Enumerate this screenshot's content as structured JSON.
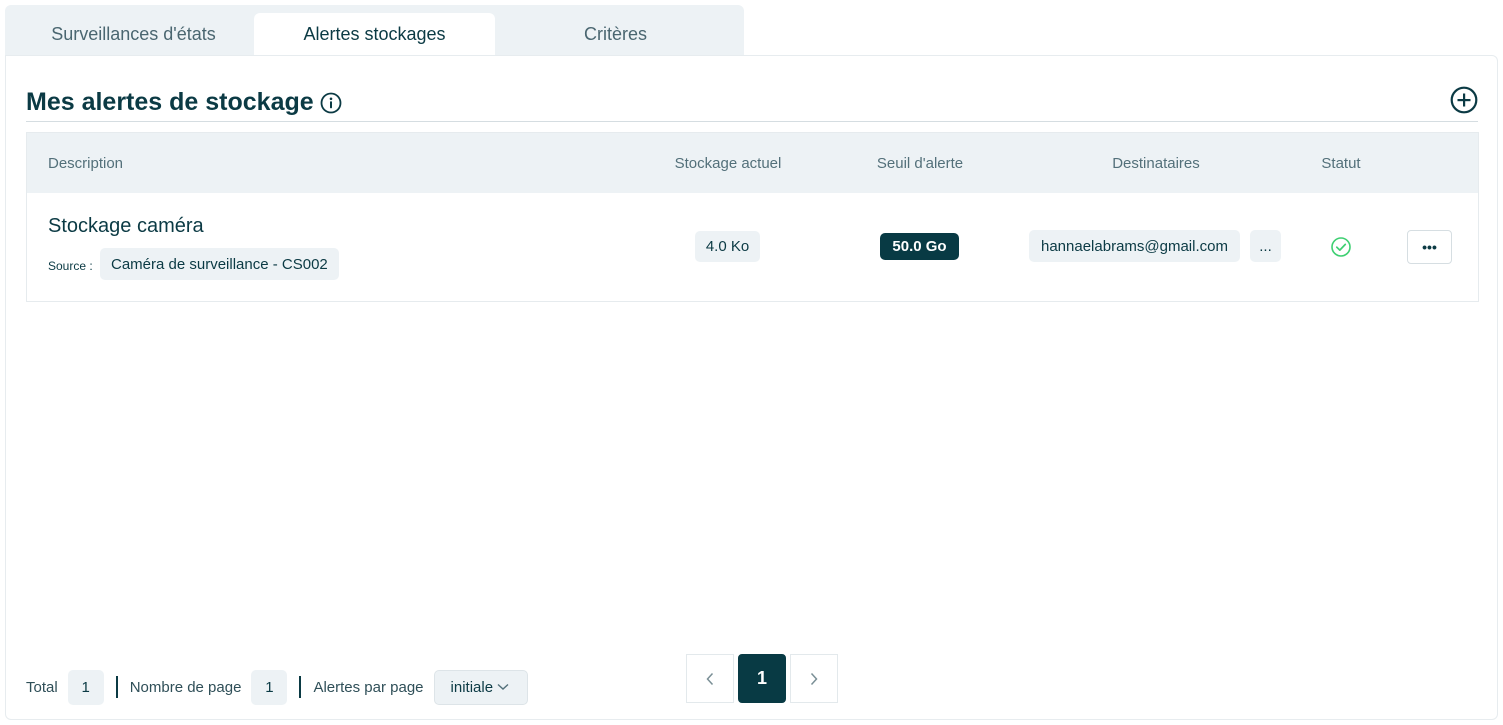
{
  "tabs": [
    {
      "label": "Surveillances d'états",
      "active": false
    },
    {
      "label": "Alertes stockages",
      "active": true
    },
    {
      "label": "Critères",
      "active": false
    }
  ],
  "header": {
    "title": "Mes alertes de stockage",
    "info_icon": "info-circle-icon",
    "add_icon": "plus-circle-icon"
  },
  "table": {
    "columns": [
      "Description",
      "Stockage actuel",
      "Seuil d'alerte",
      "Destinataires",
      "Statut"
    ],
    "rows": [
      {
        "title": "Stockage caméra",
        "source_label": "Source :",
        "source": "Caméra de surveillance - CS002",
        "current_storage": "4.0 Ko",
        "threshold": "50.0 Go",
        "recipient": "hannaelabrams@gmail.com",
        "more_recipients": "...",
        "status_icon": "check-circle-icon",
        "actions_label": "•••"
      }
    ]
  },
  "footer": {
    "total_label": "Total",
    "total_value": "1",
    "pages_label": "Nombre de page",
    "pages_value": "1",
    "per_page_label": "Alertes par page",
    "per_page_value": "initiale"
  },
  "pagination": {
    "current": "1",
    "prev_icon": "chevron-left-icon",
    "next_icon": "chevron-right-icon"
  },
  "colors": {
    "primary": "#083a44",
    "light_bg": "#edf2f5",
    "success": "#3ecf72"
  }
}
